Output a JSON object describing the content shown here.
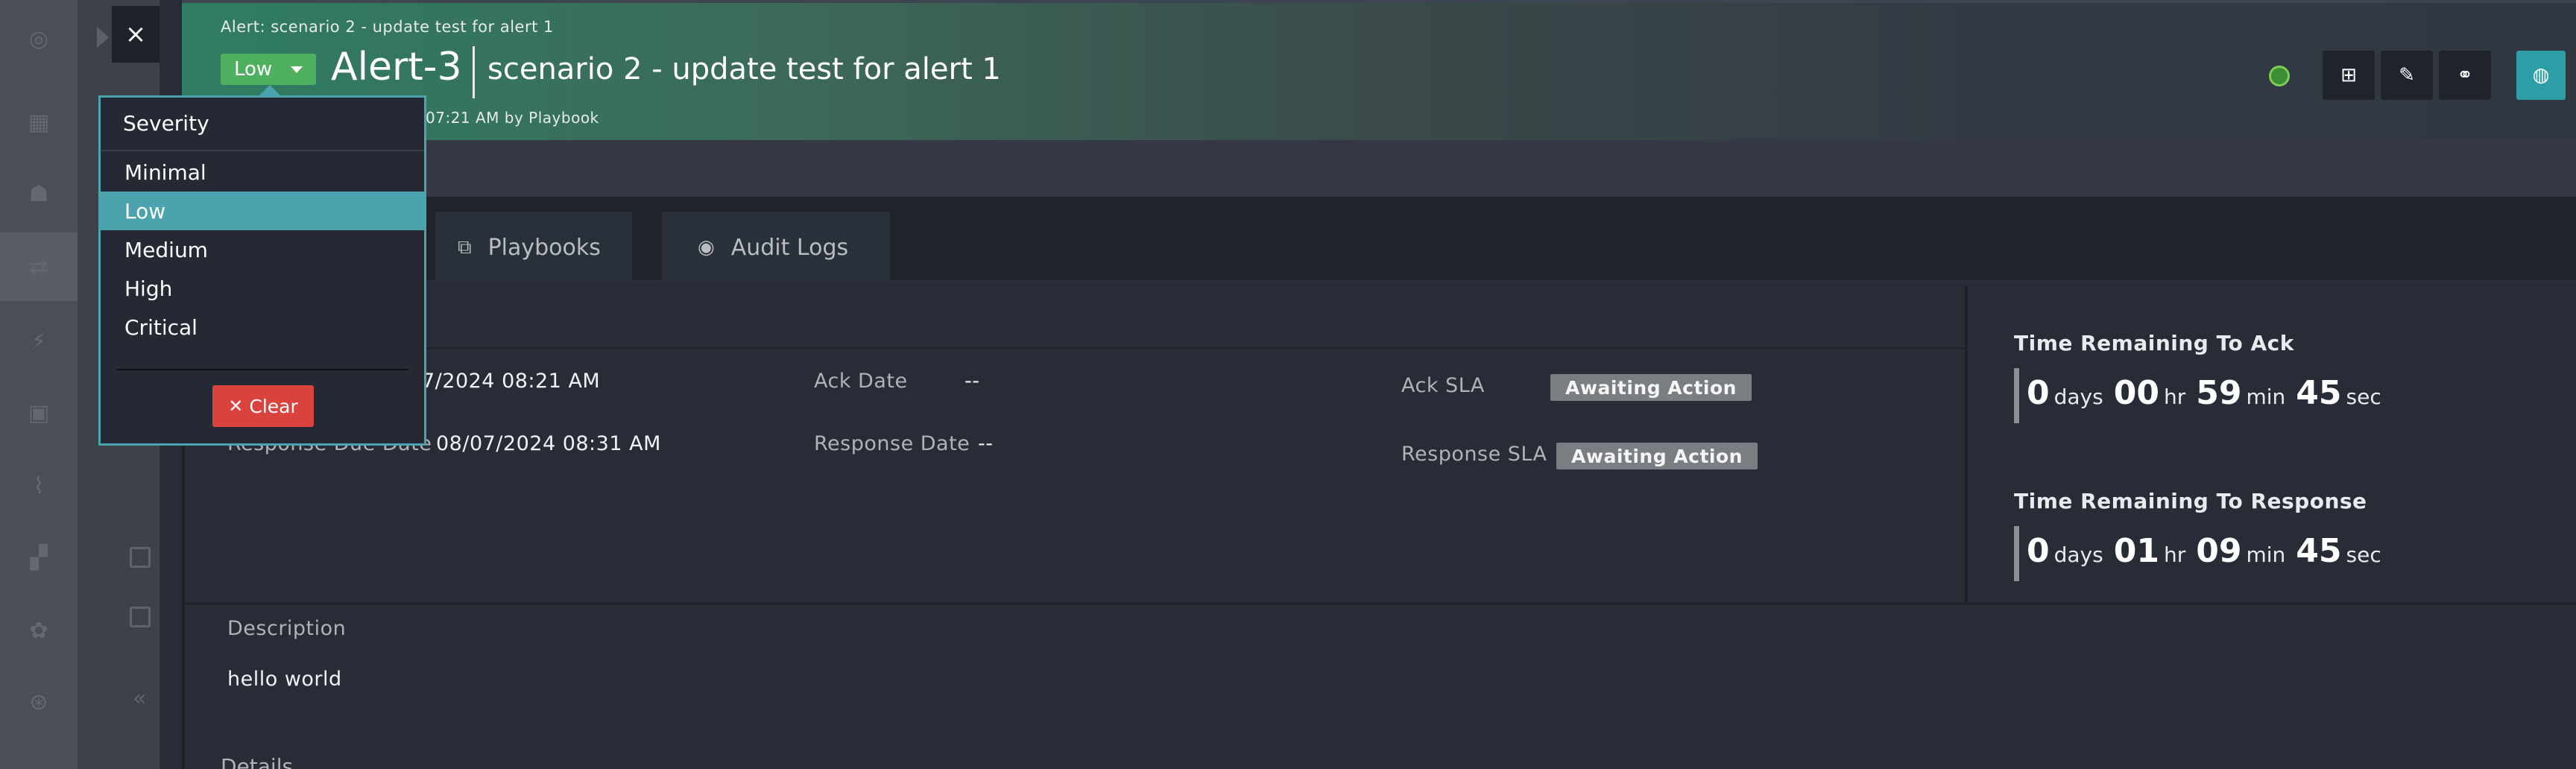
{
  "header": {
    "breadcrumb": "Alert: scenario 2 - update test for alert 1",
    "severity_button": "Low",
    "alert_id": "Alert-3",
    "alert_name": "scenario 2 - update test for alert 1",
    "created_partial": "07:21 AM by Playbook",
    "close_icon": "×"
  },
  "tabs": [
    {
      "label": "Playbooks",
      "icon": "playbook-icon"
    },
    {
      "label": "Audit Logs",
      "icon": "eye-icon"
    }
  ],
  "fields": {
    "ack_due_value_partial": "7/2024 08:21 AM",
    "response_due_label": "Response Due Date",
    "response_due_value": "08/07/2024 08:31 AM",
    "ack_date_label": "Ack Date",
    "ack_date_value": "--",
    "response_date_label": "Response Date",
    "response_date_value": "--",
    "ack_sla_label": "Ack SLA",
    "ack_sla_value": "Awaiting Action",
    "response_sla_label": "Response SLA",
    "response_sla_value": "Awaiting Action"
  },
  "timers": {
    "ack_title": "Time Remaining To Ack",
    "ack": {
      "days": "0",
      "hr": "00",
      "min": "59",
      "sec": "45"
    },
    "response_title": "Time Remaining To Response",
    "response": {
      "days": "0",
      "hr": "01",
      "min": "09",
      "sec": "45"
    },
    "units": {
      "days": "days",
      "hr": "hr",
      "min": "min",
      "sec": "sec"
    }
  },
  "description": {
    "label": "Description",
    "value": "hello world"
  },
  "details_label": "Details",
  "severity_dropdown": {
    "title": "Severity",
    "options": [
      "Minimal",
      "Low",
      "Medium",
      "High",
      "Critical"
    ],
    "selected": "Low",
    "clear_label": "Clear"
  },
  "colors": {
    "accent": "#4aa3ad",
    "severity_low": "#4fb05f",
    "clear": "#d9423d",
    "badge": "#7a7d82"
  }
}
